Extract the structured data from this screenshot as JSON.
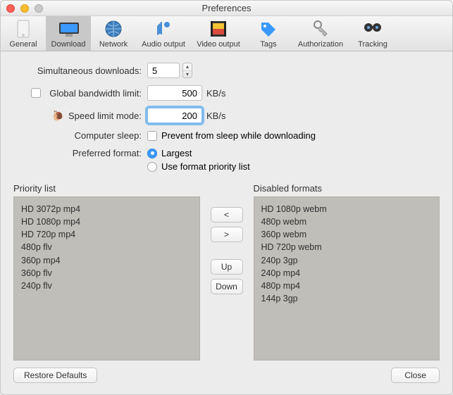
{
  "window": {
    "title": "Preferences"
  },
  "toolbar": {
    "general": "General",
    "download": "Download",
    "network": "Network",
    "audio": "Audio output",
    "video": "Video output",
    "tags": "Tags",
    "auth": "Authorization",
    "tracking": "Tracking"
  },
  "form": {
    "simultaneous_label": "Simultaneous downloads:",
    "simultaneous_value": "5",
    "global_bw_label": "Global bandwidth limit:",
    "global_bw_value": "500",
    "speed_limit_label": "Speed limit mode:",
    "speed_limit_value": "200",
    "kbs": "KB/s",
    "sleep_label": "Computer sleep:",
    "sleep_option": "Prevent from sleep while downloading",
    "format_label": "Preferred format:",
    "format_largest": "Largest",
    "format_priority": "Use format priority list"
  },
  "lists": {
    "priority_title": "Priority list",
    "priority_items": [
      "HD 3072p mp4",
      "HD 1080p mp4",
      "HD 720p mp4",
      "480p flv",
      "360p mp4",
      "360p flv",
      "240p flv"
    ],
    "disabled_title": "Disabled formats",
    "disabled_items": [
      "HD 1080p webm",
      "480p webm",
      "360p webm",
      "HD 720p webm",
      "240p 3gp",
      "240p mp4",
      "480p mp4",
      "144p 3gp"
    ],
    "lt": "<",
    "gt": ">",
    "up": "Up",
    "down": "Down"
  },
  "footer": {
    "restore": "Restore Defaults",
    "close": "Close"
  }
}
